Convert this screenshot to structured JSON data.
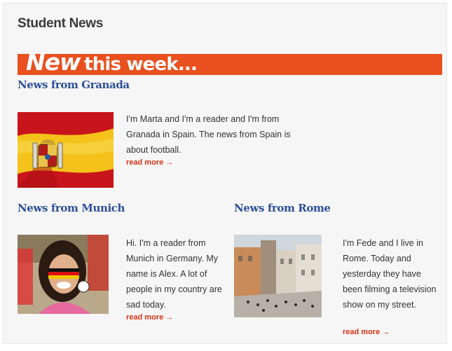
{
  "page": {
    "title": "Student News"
  },
  "banner": {
    "new_word": "New",
    "rest": "this week..."
  },
  "articles": [
    {
      "heading": "News from Granada",
      "text": "I'm Marta and I'm a reader and I'm from Granada in Spain. The news from Spain is about football.",
      "read_more": "read more →",
      "image": "spain-flag-image"
    },
    {
      "heading": "News from Munich",
      "text": "Hi. I'm a reader from Munich in Germany. My name is Alex. A lot of people in my country are sad today.",
      "read_more": "read more →",
      "image": "football-fan-photo"
    },
    {
      "heading": "News from Rome",
      "text": "I'm Fede and I live in Rome. Today and yesterday they have been filming a television show on my street.",
      "read_more": "read more →",
      "image": "rome-steps-photo"
    }
  ],
  "colors": {
    "banner": "#e8511f",
    "heading": "#2d4f98",
    "link": "#d63318"
  }
}
